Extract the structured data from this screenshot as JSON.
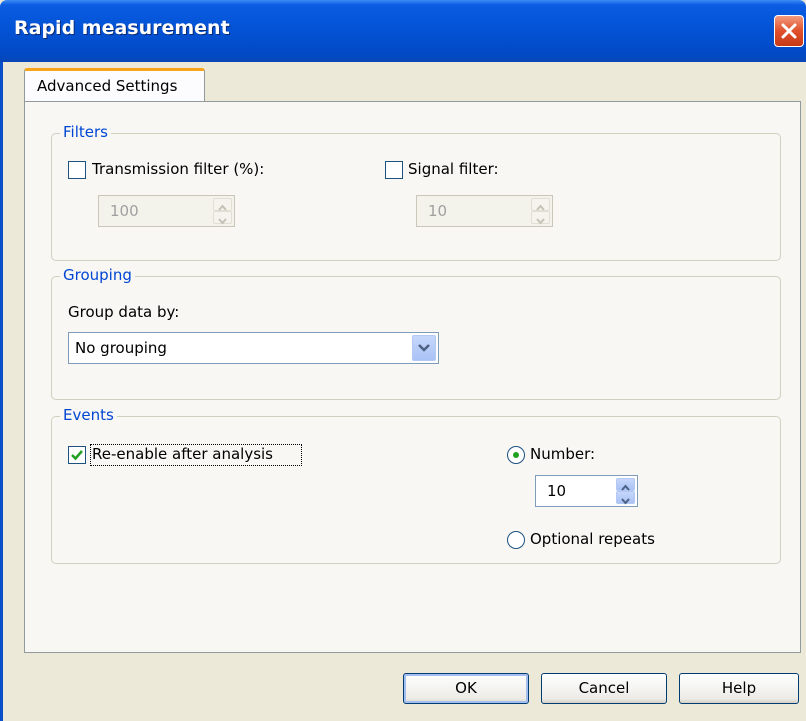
{
  "window": {
    "title": "Rapid measurement"
  },
  "tabs": [
    {
      "label": "Advanced Settings",
      "active": true
    }
  ],
  "filters": {
    "legend": "Filters",
    "transmission": {
      "label": "Transmission filter (%):",
      "checked": false,
      "value": "100"
    },
    "signal": {
      "label": "Signal filter:",
      "checked": false,
      "value": "10"
    }
  },
  "grouping": {
    "legend": "Grouping",
    "group_by_label": "Group data by:",
    "group_by_value": "No grouping"
  },
  "events": {
    "legend": "Events",
    "reenable": {
      "label": "Re-enable after analysis",
      "checked": true
    },
    "number": {
      "label": "Number:",
      "selected": true,
      "value": "10"
    },
    "optional": {
      "label": "Optional repeats",
      "selected": false
    }
  },
  "buttons": {
    "ok": "OK",
    "cancel": "Cancel",
    "help": "Help"
  },
  "colors": {
    "title_bar": "#0352d4",
    "accent_tab": "#f7a41a",
    "group_legend": "#0046d5",
    "face": "#ece9d8"
  },
  "icons": {
    "close": "close-icon",
    "dropdown": "chevron-down-icon",
    "spin_up": "spin-up-icon",
    "spin_down": "spin-down-icon",
    "check": "checkmark-icon"
  }
}
